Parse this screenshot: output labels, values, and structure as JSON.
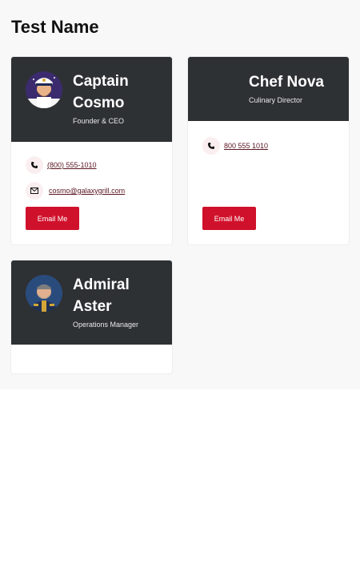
{
  "page": {
    "title": "Test Name"
  },
  "members": [
    {
      "name": "Captain Cosmo",
      "role": "Founder & CEO",
      "phone": "(800) 555-1010",
      "email": "cosmo@galaxygrill.com",
      "button": "Email Me",
      "avatar_icon": "astronaut-captain-avatar"
    },
    {
      "name": "Chef Nova",
      "role": "Culinary Director",
      "phone": "800 555 1010",
      "button": "Email Me"
    },
    {
      "name": "Admiral Aster",
      "role": "Operations Manager",
      "avatar_icon": "admiral-avatar"
    }
  ],
  "colors": {
    "card_header": "#2e3134",
    "accent": "#d0112b",
    "background": "#f8f8f8",
    "link": "#5a1622"
  }
}
